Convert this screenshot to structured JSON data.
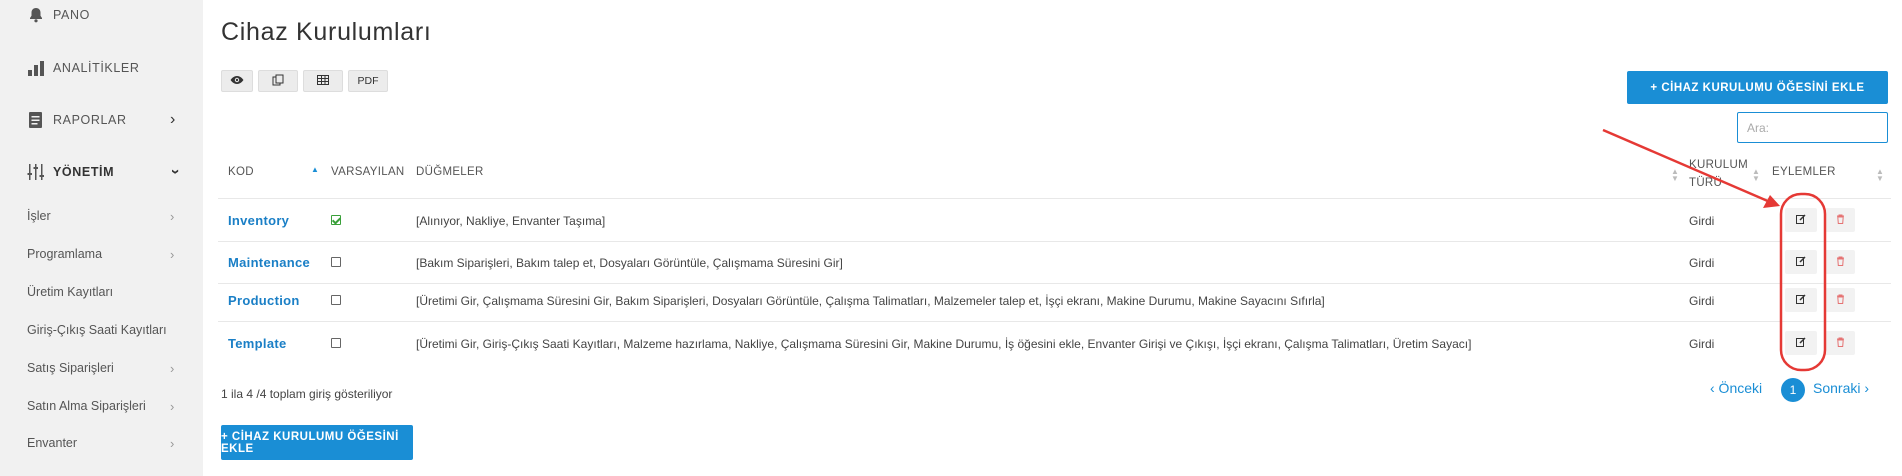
{
  "sidebar": {
    "pano": "PANO",
    "analitikler": "ANALİTİKLER",
    "raporlar": "RAPORLAR",
    "yonetim": "YÖNETİM",
    "items": [
      {
        "label": "İşler",
        "has_arrow": true
      },
      {
        "label": "Programlama",
        "has_arrow": true
      },
      {
        "label": "Üretim Kayıtları",
        "has_arrow": false
      },
      {
        "label": "Giriş-Çıkış Saati Kayıtları",
        "has_arrow": false
      },
      {
        "label": "Satış Siparişleri",
        "has_arrow": true
      },
      {
        "label": "Satın Alma Siparişleri",
        "has_arrow": true
      },
      {
        "label": "Envanter",
        "has_arrow": true
      }
    ]
  },
  "main": {
    "title": "Cihaz Kurulumları",
    "toolbar": {
      "pdf": "PDF"
    },
    "add_button": "+ CİHAZ KURULUMU ÖĞESİNİ EKLE",
    "search_placeholder": "Ara:",
    "columns": {
      "kod": "KOD",
      "varsayilan": "VARSAYILAN",
      "dugmeler": "DÜĞMELER",
      "kurulum": "KURULUM TÜRÜ",
      "eylemler": "EYLEMLER"
    },
    "rows": [
      {
        "kod": "Inventory",
        "default": true,
        "buttons": "[Alınıyor, Nakliye, Envanter Taşıma]",
        "type": "Girdi"
      },
      {
        "kod": "Maintenance",
        "default": false,
        "buttons": "[Bakım Siparişleri, Bakım talep et, Dosyaları Görüntüle, Çalışmama Süresini Gir]",
        "type": "Girdi"
      },
      {
        "kod": "Production",
        "default": false,
        "buttons": "[Üretimi Gir, Çalışmama Süresini Gir, Bakım Siparişleri, Dosyaları Görüntüle, Çalışma Talimatları, Malzemeler talep et, İşçi ekranı, Makine Durumu, Makine Sayacını Sıfırla]",
        "type": "Girdi"
      },
      {
        "kod": "Template",
        "default": false,
        "buttons": "[Üretimi Gir, Giriş-Çıkış Saati Kayıtları, Malzeme hazırlama, Nakliye, Çalışmama Süresini Gir, Makine Durumu, İş öğesini ekle, Envanter Girişi ve Çıkışı, İşçi ekranı, Çalışma Talimatları, Üretim Sayacı]",
        "type": "Girdi"
      }
    ],
    "info": "1 ila 4 /4 toplam giriş gösteriliyor",
    "pagination": {
      "prev": "‹ Önceki",
      "current": "1",
      "next": "Sonraki ›"
    }
  },
  "colors": {
    "accent": "#1a8ed5",
    "annotation": "#e53935"
  }
}
